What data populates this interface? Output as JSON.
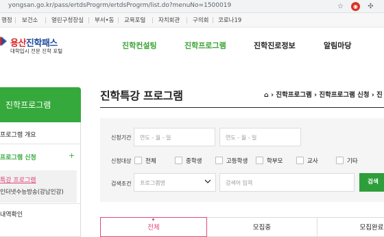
{
  "browser": {
    "url": "yongsan.go.kr/pass/ertdsProgrm/ertdsProgrm/list.do?menuNo=1500019"
  },
  "top_links": [
    "행정",
    "보건소",
    "열린구청장실",
    "부서•동",
    "교육포털",
    "자치회관",
    "구의회",
    "코로나19"
  ],
  "header": {
    "logo_part1": "용산",
    "logo_part2": "진학패스",
    "logo_sub": "대학입시 전문 진학 포털",
    "nav": [
      "진학컨설팅",
      "진학프로그램",
      "진학진로정보",
      "알림마당"
    ]
  },
  "sidebar": {
    "title": "진학프로그램",
    "items": [
      "프로그램 개요",
      "프로그램 신청",
      "+",
      "특강 프로그램",
      "인터넷수능방송(강남인강)",
      "내역확인"
    ]
  },
  "content": {
    "title": "진학특강 프로그램",
    "breadcrumb": [
      "진학프로그램",
      "진학프로그램 신청",
      "진"
    ]
  },
  "search": {
    "period_label": "신청기간",
    "date_start_placeholder": "연도 - 월 - 일",
    "date_end_placeholder": "연도 - 월 - 일",
    "target_label": "신청대상",
    "targets": [
      "전체",
      "중학생",
      "고등학생",
      "학부모",
      "교사",
      "기타"
    ],
    "condition_label": "검색조건",
    "select_placeholder": "프로그램명",
    "keyword_placeholder": "검색어 입력",
    "search_button": "검색"
  },
  "tabs": [
    "전체",
    "모집중",
    "모집완료"
  ],
  "colors": {
    "brand_green": "#35a93b",
    "brand_blue": "#1f4b9c",
    "brand_red": "#d62828",
    "active_tab_pink": "#e0467a"
  }
}
